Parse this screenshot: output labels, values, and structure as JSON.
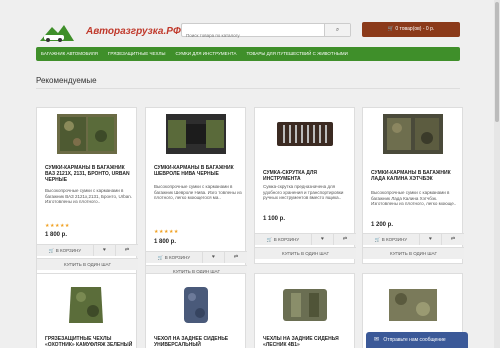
{
  "header": {
    "logo_text": "Авторазгрузка.РФ",
    "search_placeholder": "Поиск товара по каталогу",
    "cart_label": "0 товар(ов) - 0 р."
  },
  "nav": [
    "Багажник автомобиля",
    "Грязезащитные чехлы",
    "Сумки для инструмента",
    "Товары для путешествий с животными"
  ],
  "section_title": "Рекомендуемые",
  "products": [
    {
      "name": "Сумки-карманы в багажник ВАЗ 2121х, 2131, Бронто, Urban ЧЕРНЫЕ",
      "desc": "Высокопрочные сумки с карманами в багажник ВАЗ 2121х,2131, Бронто, Urban. Изготовлены из плотного..",
      "stars": "★★★★★",
      "rating": 5,
      "price": "1 800 р."
    },
    {
      "name": "Сумки-карманы в багажник Шевроле Нива черные",
      "desc": "Высокопрочные сумки с карманами в багажник Шевроле Нива. Изго товлены из плотного, легко моющегося ма..",
      "stars": "★★★★★",
      "rating": 5,
      "price": "1 800 р."
    },
    {
      "name": "Сумка-скрутка для инструмента",
      "desc": "Сумка-скрутка предназначена для удобного хранения и транспортировки ручных инструментов вместо ящика..",
      "price": "1 100 р."
    },
    {
      "name": "Сумки-карманы в багажник Лада Калина Хэтчбэк",
      "desc": "Высокопрочные сумки с карманами в багажник Лада Калина Хэтчбэк. Изготовлены из плотного, легко моюще..",
      "price": "1 200 р."
    },
    {
      "name": "Грязезащитные чехлы «Охотник» камуфляж зеленый"
    },
    {
      "name": "Чехол на заднее сиденье универсальный"
    },
    {
      "name": "Чехлы на задние сиденья «Лесник 4В1»"
    },
    {
      "name": ""
    }
  ],
  "buttons": {
    "add_to_cart": "В КОРЗИНУ",
    "one_click": "Купить в один шаг",
    "wishlist": "♥",
    "compare": "⇄"
  },
  "chat_label": "Отправьте нам сообщение",
  "colors": {
    "nav_green": "#3f8f2a",
    "cart_brown": "#8b3a1a",
    "logo_red": "#c0392b",
    "chat_blue": "#3b5998",
    "star": "#f0a020"
  },
  "icons": {
    "search": "search-icon",
    "cart": "cart-icon",
    "wishlist": "heart-icon",
    "compare": "compare-icon",
    "chat": "chat-icon"
  }
}
